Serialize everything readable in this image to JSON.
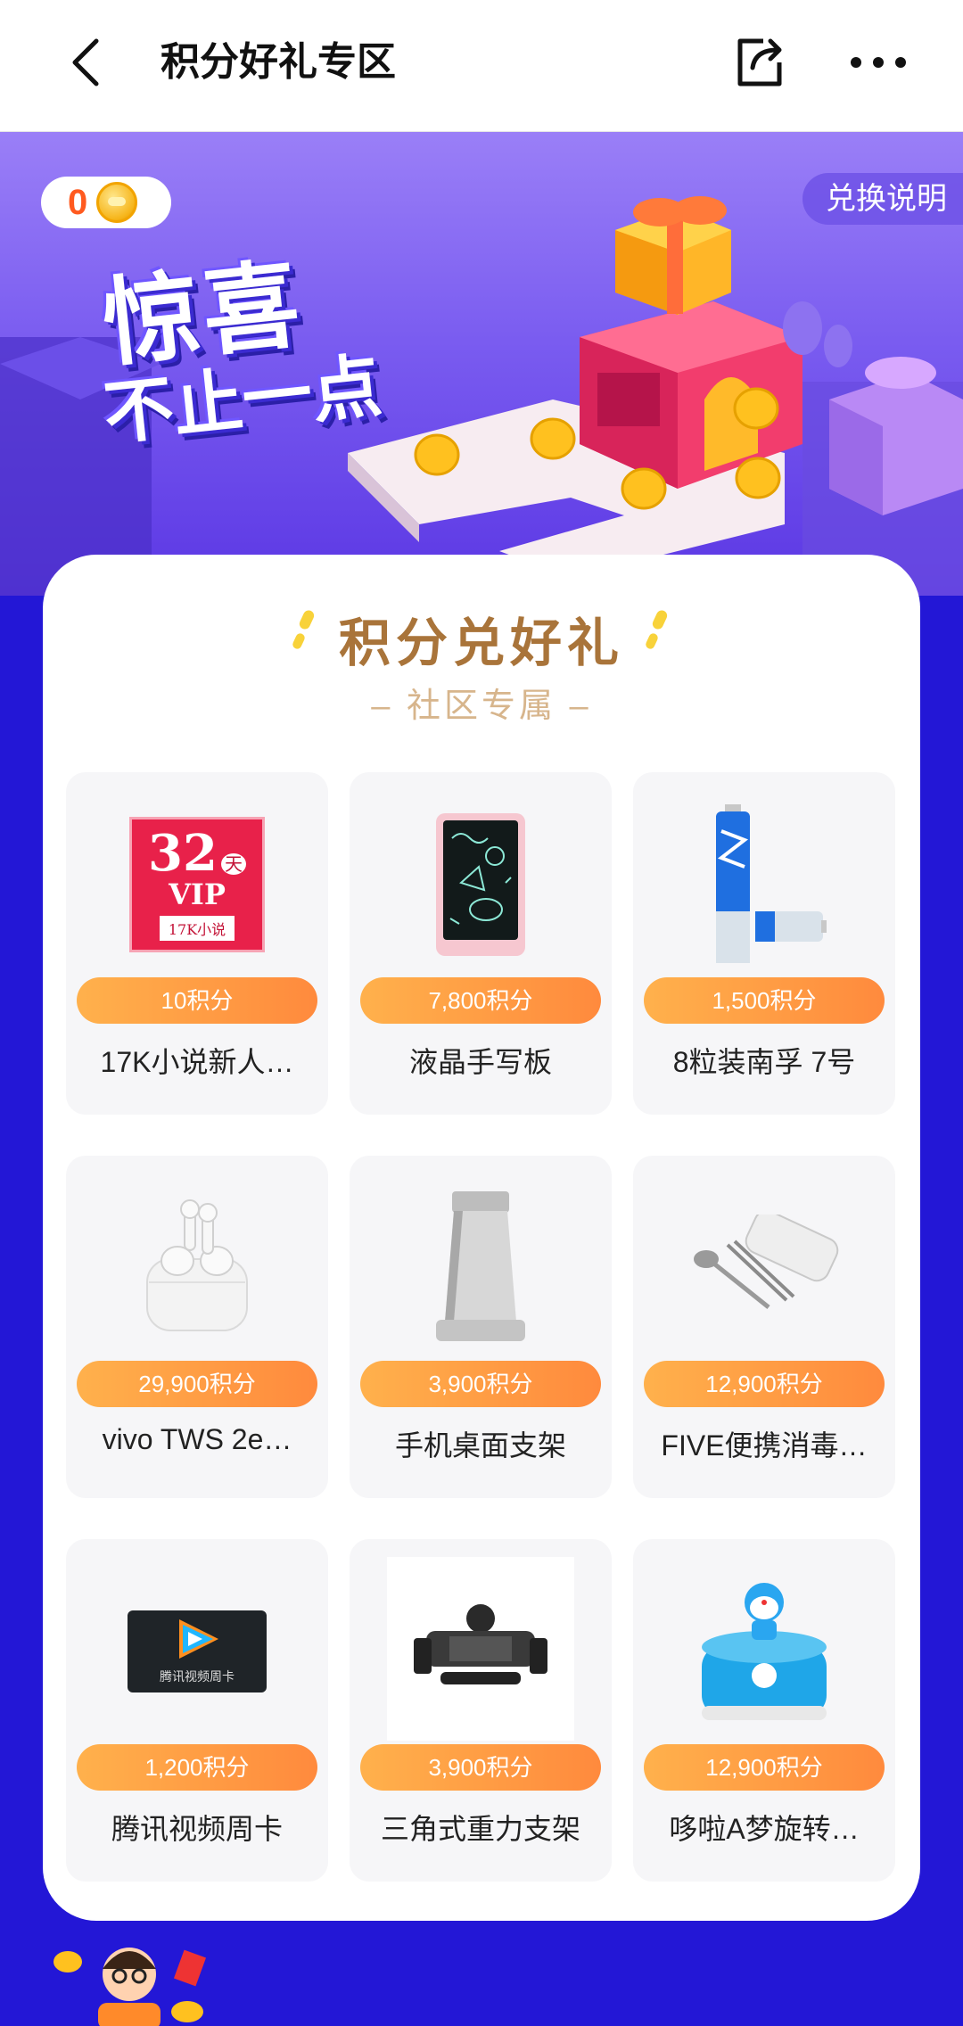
{
  "header": {
    "title": "积分好礼专区"
  },
  "banner": {
    "points": "0",
    "rules_label": "兑换说明",
    "slogan_line1": "惊喜",
    "slogan_line2": "不止一点"
  },
  "section": {
    "title": "积分兑好礼",
    "subtitle": "– 社区专属 –"
  },
  "products": [
    {
      "price": "10积分",
      "name": "17K小说新人…",
      "img_text_big": "32",
      "img_text_tian": "天",
      "img_text_mid": "VIP",
      "img_text_sm": "17K小说"
    },
    {
      "price": "7,800积分",
      "name": "液晶手写板"
    },
    {
      "price": "1,500积分",
      "name": "8粒装南孚 7号"
    },
    {
      "price": "29,900积分",
      "name": "vivo TWS 2e…"
    },
    {
      "price": "3,900积分",
      "name": "手机桌面支架"
    },
    {
      "price": "12,900积分",
      "name": "FIVE便携消毒…"
    },
    {
      "price": "1,200积分",
      "name": "腾讯视频周卡",
      "img_text": "腾讯视频周卡"
    },
    {
      "price": "3,900积分",
      "name": "三角式重力支架"
    },
    {
      "price": "12,900积分",
      "name": "哆啦A梦旋转…"
    }
  ],
  "colors": {
    "accent_orange": "#ff8a3d",
    "title_gold": "#a9743a",
    "page_bg": "#2317d6"
  },
  "icons": {
    "back": "chevron-left-icon",
    "share": "share-icon",
    "more": "more-dots-icon",
    "coin": "coin-icon"
  }
}
